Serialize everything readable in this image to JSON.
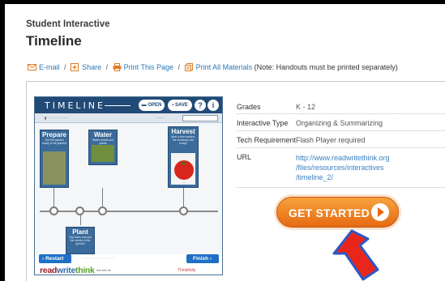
{
  "page": {
    "pretitle": "Student Interactive",
    "title": "Timeline"
  },
  "links": {
    "email": "E-mail",
    "share": "Share",
    "print_page": "Print This Page",
    "print_all": "Print All Materials",
    "note": "(Note: Handouts must be printed separately)",
    "separator": "/"
  },
  "thumbnail": {
    "app_title": "TIMELINE",
    "open_label": "OPEN",
    "save_label": "SAVE",
    "help_label": "?",
    "info_label": "i",
    "close_label": "✕",
    "cards": [
      {
        "title": "Prepare",
        "sub": "Get the garden ready to be planted"
      },
      {
        "title": "Water",
        "sub": "Water seeds and plants"
      },
      {
        "title": "Harvest",
        "sub": "After a few months, the tomatoes are ready!"
      },
      {
        "title": "Plant",
        "sub": "Dig holes and put the seeds in the ground"
      }
    ],
    "restart_label": "Restart",
    "finish_label": "Finish",
    "brand_read": "read",
    "brand_write": "write",
    "brand_think": "think",
    "thinkfinity": "Thinkfinity"
  },
  "info": {
    "rows": [
      {
        "key": "Grades",
        "value": "K - 12"
      },
      {
        "key": "Interactive Type",
        "value": "Organizing & Summarizing"
      },
      {
        "key": "Tech Requirement",
        "value": "Flash Player required"
      },
      {
        "key": "URL",
        "value_lines": [
          "http://www.readwritethink.org",
          "/files/resources/interactives",
          "/timeline_2/"
        ]
      }
    ]
  },
  "cta": {
    "label": "GET STARTED"
  },
  "colors": {
    "link": "#2a79b8",
    "cta_orange": "#e66a12",
    "arrow_red": "#e8261b",
    "arrow_blue": "#2d58c7"
  }
}
